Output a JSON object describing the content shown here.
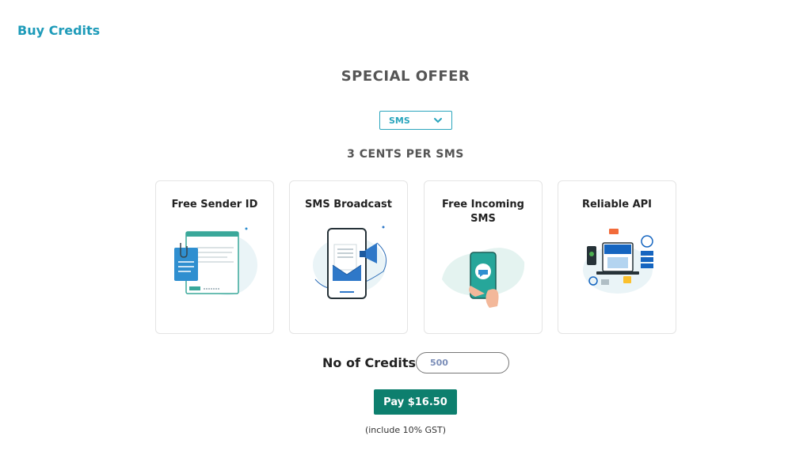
{
  "page": {
    "title": "Buy Credits"
  },
  "offer": {
    "title": "SPECIAL OFFER",
    "product_select": {
      "value": "SMS"
    },
    "rate": "3 CENTS PER SMS"
  },
  "features": [
    {
      "title": "Free Sender ID",
      "icon": "sender-id-illustration"
    },
    {
      "title": "SMS Broadcast",
      "icon": "broadcast-illustration"
    },
    {
      "title": "Free Incoming SMS",
      "icon": "incoming-sms-illustration"
    },
    {
      "title": "Reliable API",
      "icon": "api-illustration"
    }
  ],
  "purchase": {
    "credits_label": "No of Credits:",
    "credits_value": "500",
    "pay_label": "Pay $16.50",
    "gst_note": "(include 10% GST)"
  },
  "colors": {
    "accent": "#1e9bb9",
    "pay_button": "#0d7f6e"
  }
}
